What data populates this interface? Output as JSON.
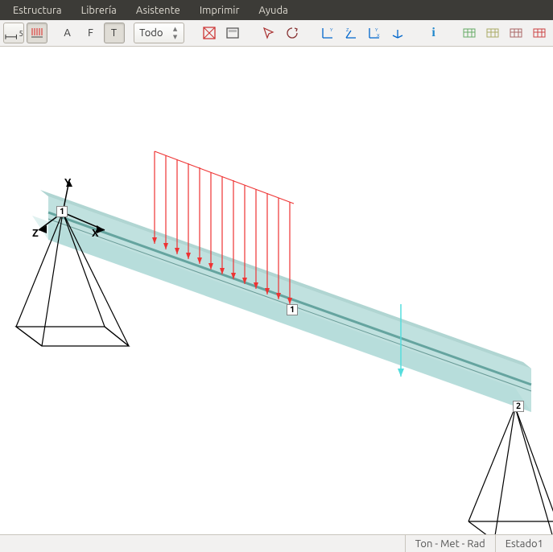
{
  "menu": {
    "items": [
      "Estructura",
      "Librería",
      "Asistente",
      "Imprimir",
      "Ayuda"
    ]
  },
  "toolbar": {
    "label_5": "5",
    "label_A": "A",
    "label_F": "F",
    "label_T": "T",
    "combo_value": "Todo"
  },
  "viewport": {
    "axes": {
      "x": "X",
      "y": "Y",
      "z": "Z"
    },
    "nodes": {
      "left": "1",
      "right": "2"
    },
    "load_label": "1"
  },
  "status": {
    "units": "Ton - Met - Rad",
    "state": "Estado1"
  }
}
